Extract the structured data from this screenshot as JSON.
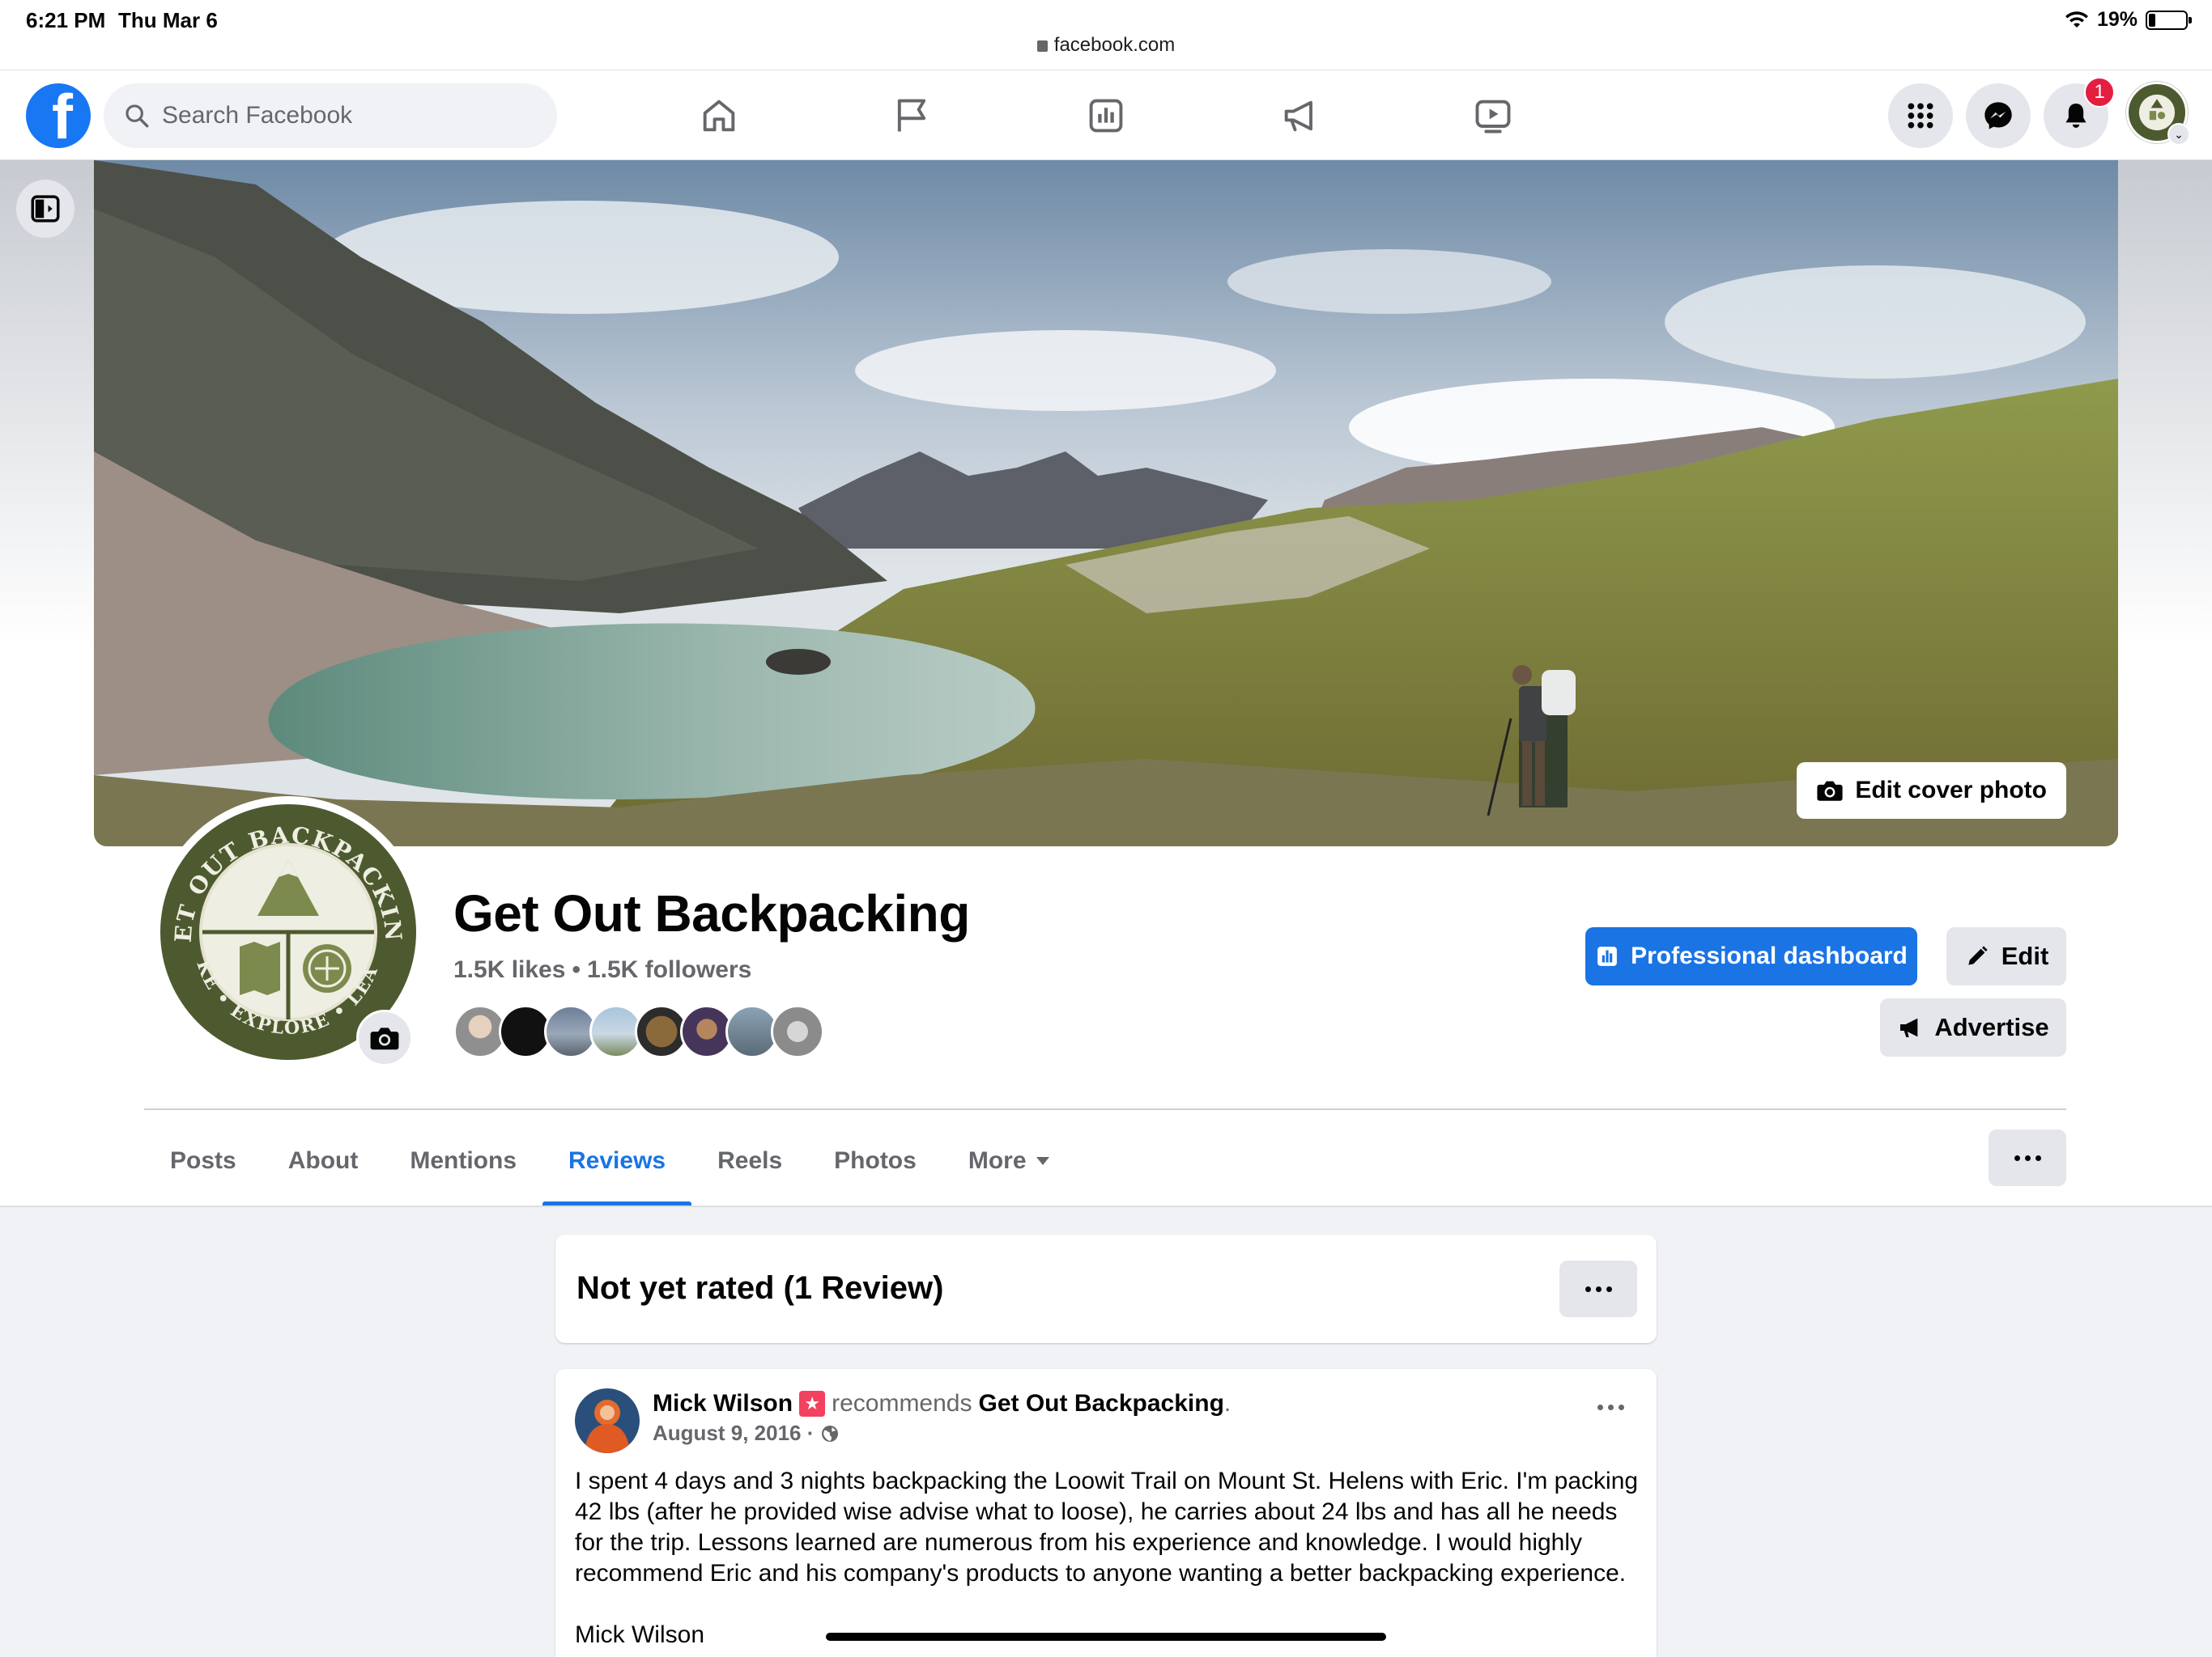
{
  "status_bar": {
    "time": "6:21 PM",
    "date": "Thu Mar 6",
    "url": "facebook.com",
    "battery": "19%",
    "battery_level": 0.19
  },
  "topnav": {
    "logo_letter": "f",
    "search_placeholder": "Search Facebook",
    "nav_icons": [
      "home-icon",
      "pages-flag-icon",
      "insights-icon",
      "ads-megaphone-icon",
      "watch-video-icon"
    ],
    "right_icons": [
      "menu-grid-icon",
      "messenger-icon",
      "notifications-bell-icon"
    ],
    "notification_count": "1"
  },
  "page": {
    "name": "Get Out Backpacking",
    "likes": "1.5K likes",
    "followers": "1.5K followers",
    "avatar_text": {
      "top": "GET OUT BACKPACKING",
      "bottom": "HIKE • EXPLORE • LEARN"
    },
    "edit_cover_label": "Edit cover photo",
    "professional_dashboard_label": "Professional dashboard",
    "edit_label": "Edit",
    "advertise_label": "Advertise",
    "friend_avatar_count": 8,
    "colors": {
      "brand_blue": "#1b74e4",
      "logo_green": "#4d5a2f",
      "logo_cream": "#efeee2"
    }
  },
  "tabs": [
    {
      "label": "Posts",
      "active": false
    },
    {
      "label": "About",
      "active": false
    },
    {
      "label": "Mentions",
      "active": false
    },
    {
      "label": "Reviews",
      "active": true
    },
    {
      "label": "Reels",
      "active": false
    },
    {
      "label": "Photos",
      "active": false
    },
    {
      "label": "More",
      "active": false
    }
  ],
  "rating": {
    "title": "Not yet rated (1 Review)"
  },
  "review": {
    "author": "Mick Wilson",
    "verb": "recommends",
    "target": "Get Out Backpacking",
    "date": "August 9, 2016 ·",
    "body": "I spent 4 days and 3 nights backpacking the Loowit Trail on Mount St. Helens with Eric. I'm packing 42 lbs (after he provided wise advise what to loose), he carries about 24 lbs and has all he needs for the trip. Lessons learned are numerous from his experience and knowledge. I would highly recommend Eric and his company's products to anyone wanting a better backpacking experience.",
    "signature": "Mick Wilson"
  }
}
